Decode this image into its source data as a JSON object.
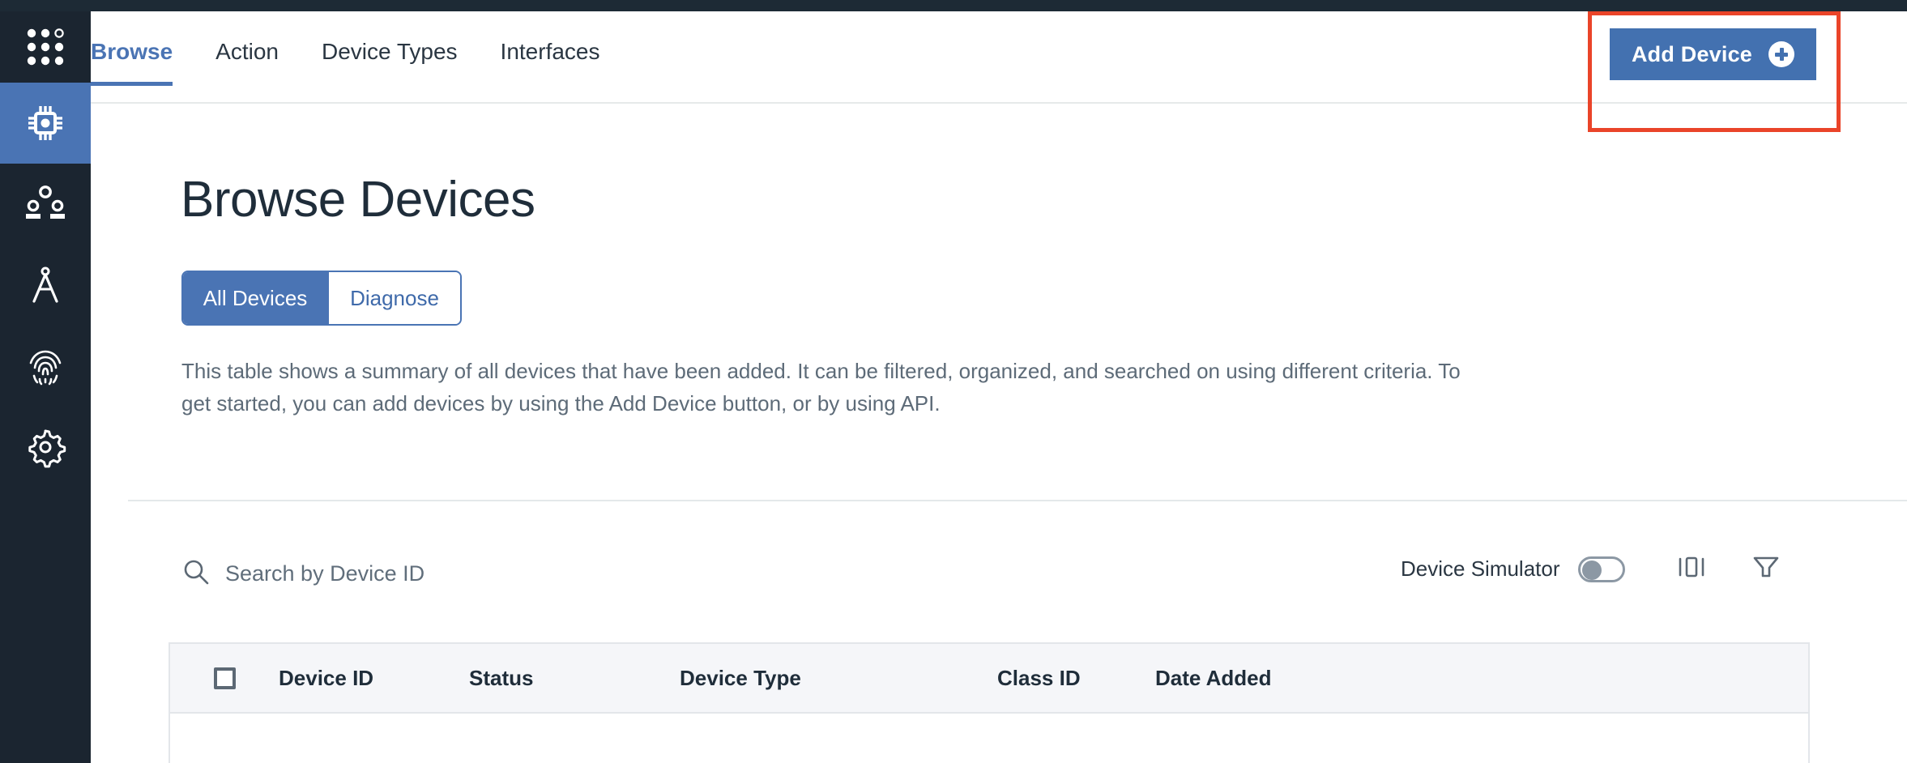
{
  "sidebar": {
    "items": [
      {
        "name": "app-launcher",
        "icon": "grid-dots-icon",
        "active": false
      },
      {
        "name": "devices",
        "icon": "chip-icon",
        "active": true
      },
      {
        "name": "users",
        "icon": "people-group-icon",
        "active": false
      },
      {
        "name": "design",
        "icon": "compass-icon",
        "active": false
      },
      {
        "name": "security",
        "icon": "fingerprint-icon",
        "active": false
      },
      {
        "name": "settings",
        "icon": "gear-icon",
        "active": false
      }
    ]
  },
  "header": {
    "tabs": [
      {
        "label": "Browse",
        "active": true
      },
      {
        "label": "Action",
        "active": false
      },
      {
        "label": "Device Types",
        "active": false
      },
      {
        "label": "Interfaces",
        "active": false
      }
    ],
    "add_device_label": "Add Device",
    "add_device_icon": "plus-circle-icon"
  },
  "main": {
    "title": "Browse Devices",
    "segments": [
      {
        "label": "All Devices",
        "selected": true
      },
      {
        "label": "Diagnose",
        "selected": false
      }
    ],
    "description": "This table shows a summary of all devices that have been added. It can be filtered, organized, and searched on using different criteria. To get started, you can add devices by using the Add Device button, or by using API.",
    "search": {
      "placeholder": "Search by Device ID",
      "icon": "search-icon"
    },
    "toolbar": {
      "simulator_label": "Device Simulator",
      "simulator_on": false,
      "columns_icon": "columns-icon",
      "filter_icon": "filter-funnel-icon"
    },
    "table": {
      "columns": [
        "Device ID",
        "Status",
        "Device Type",
        "Class ID",
        "Date Added"
      ],
      "rows": []
    }
  },
  "colors": {
    "sidebar_bg": "#1b2530",
    "accent_blue": "#4a74b4",
    "button_blue": "#4371b0",
    "annotation_red": "#ea4429",
    "table_header_bg": "#f5f6f9",
    "text_dark": "#1f2d3a",
    "text_muted": "#5d6b78"
  }
}
